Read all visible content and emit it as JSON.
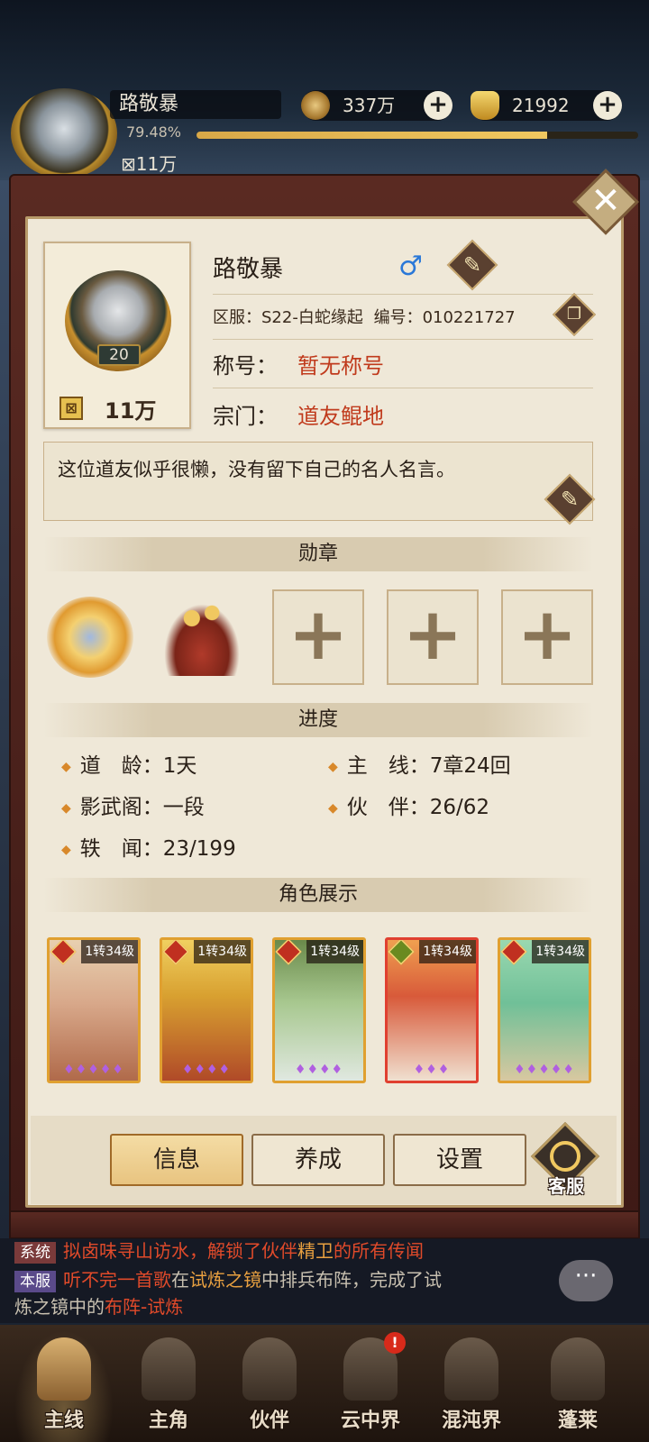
{
  "hud": {
    "player_name": "路敬暴",
    "exp_percent": "79.48%",
    "exp_fraction": 0.7948,
    "level": "20",
    "power": "11万",
    "copper": {
      "value": "337万",
      "icon": "coin-icon",
      "plus": "+"
    },
    "gold": {
      "value": "21992",
      "icon": "ingot-icon",
      "plus": "+"
    }
  },
  "profile": {
    "name": "路敬暴",
    "gender_symbol": "♂",
    "level": "20",
    "power": "11万",
    "server_label": "区服：",
    "server_value": "S22-白蛇缘起",
    "id_label": "编号：",
    "id_value": "010221727",
    "title_label": "称号：",
    "title_value": "暂无称号",
    "sect_label": "宗门：",
    "sect_value": "道友鲲地",
    "motto": "这位道友似乎很懒，没有留下自己的名人名言。",
    "close_symbol": "✕",
    "edit_symbol": "✎",
    "copy_symbol": "❐"
  },
  "medals": {
    "header": "勋章",
    "slots": [
      {
        "icon": "golden-lotus-medal-icon"
      },
      {
        "icon": "treasure-chest-medal-icon"
      },
      {
        "empty": "+"
      },
      {
        "empty": "+"
      },
      {
        "empty": "+"
      }
    ]
  },
  "progress": {
    "header": "进度",
    "items": [
      {
        "label": "道　龄：",
        "value": "1天"
      },
      {
        "label": "主　线：",
        "value": "7章24回"
      },
      {
        "label": "影武阁：",
        "value": "一段"
      },
      {
        "label": "伙　伴：",
        "value": "26/62"
      },
      {
        "label": "轶　闻：",
        "value": "23/199"
      }
    ]
  },
  "characters": {
    "header": "角色展示",
    "cards": [
      {
        "level": "1转34级",
        "stars": "♦♦♦♦♦",
        "frame": "gold",
        "type": "red"
      },
      {
        "level": "1转34级",
        "stars": "♦♦♦♦",
        "frame": "gold",
        "type": "red"
      },
      {
        "level": "1转34级",
        "stars": "♦♦♦♦",
        "frame": "gold",
        "type": "red"
      },
      {
        "level": "1转34级",
        "stars": "♦♦♦",
        "frame": "red",
        "type": "green"
      },
      {
        "level": "1转34级",
        "stars": "♦♦♦♦♦",
        "frame": "gold",
        "type": "red"
      }
    ]
  },
  "buttons": {
    "info": "信息",
    "train": "养成",
    "settings": "设置",
    "service": "客服"
  },
  "chat": {
    "line1_tag": "系统",
    "line1_a": "拟卤味寻山访水，解锁了伙伴",
    "line1_b": "精卫",
    "line1_c": "的所有传闻",
    "line2_tag": "本服",
    "line2_a": "听不完一首歌",
    "line2_b": "在",
    "line2_c": "试炼之镜",
    "line2_d": "中排兵布阵，完成了试",
    "line3_a": "炼之镜中的",
    "line3_b": "布阵-试炼",
    "bubble": "···"
  },
  "nav": {
    "items": [
      {
        "label": "主线",
        "icon": "crossed-swords-icon"
      },
      {
        "label": "主角",
        "icon": "hero-icon"
      },
      {
        "label": "伙伴",
        "icon": "partner-icon"
      },
      {
        "label": "云中界",
        "icon": "cloud-palace-icon"
      },
      {
        "label": "混沌界",
        "icon": "chaos-realm-icon"
      },
      {
        "label": "蓬莱",
        "icon": "penglai-icon"
      }
    ],
    "alert": "!"
  },
  "colors": {
    "accent_red": "#c03a1c",
    "panel_bg": "#efe8d8",
    "frame_brown": "#5a2a22"
  }
}
